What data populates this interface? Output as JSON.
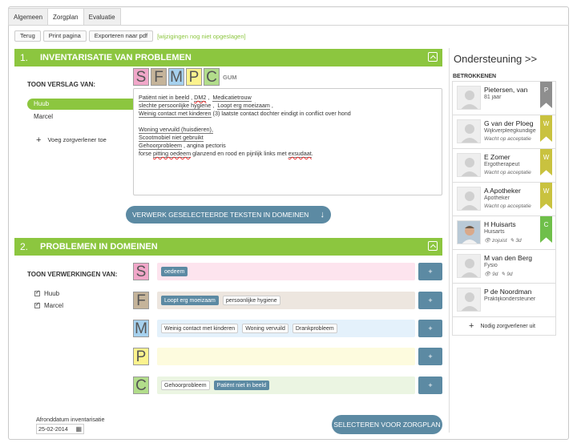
{
  "tabs": [
    {
      "label": "Algemeen"
    },
    {
      "label": "Zorgplan"
    },
    {
      "label": "Evaluatie"
    }
  ],
  "toolbar": {
    "back": "Terug",
    "print": "Print pagina",
    "export": "Exporteren naar pdf",
    "warning": "[wijzigingen nog niet opgeslagen]"
  },
  "section1": {
    "number": "1.",
    "title": "INVENTARISATIE VAN PROBLEMEN",
    "show_report_label": "TOON VERSLAG VAN:",
    "reporters": [
      "Huub",
      "Marcel"
    ],
    "add_caregiver": "Voeg zorgverlener toe",
    "letters": [
      "S",
      "F",
      "M",
      "P",
      "C"
    ],
    "letter_colors": [
      "#f1a7c9",
      "#c5b49a",
      "#a6d1ee",
      "#fbf28e",
      "#b2dd8b"
    ],
    "eraser": "GUM",
    "text_lines": {
      "l1a": "Patiënt niet in beeld",
      "l1b": "DM2",
      "l1c": "Medicatietrouw",
      "l2a": "slechte persoonlijke hygiene",
      "l2b": "Loopt erg moeizaam",
      "l3a": "Weinig contact met kinderen",
      "l3b": " (3) laatste contact dochter eindigt in conflict over hond",
      "l4": "Woning vervuild (huisdieren),",
      "l5": "Scootmobiel niet gebruikt",
      "l6a": "Gehoorprobleem",
      "l6b": " , angina pectoris",
      "l7a": "forse ",
      "l7b": "pitting oedeem",
      "l7c": " glanzend en rood en pijnlijk links met ",
      "l7d": "exsudaat",
      "l7e": "."
    },
    "process_button": "VERWERK GESELECTEERDE TEKSTEN IN DOMEINEN"
  },
  "section2": {
    "number": "2.",
    "title": "PROBLEMEN IN DOMEINEN",
    "show_processing_label": "TOON VERWERKINGEN VAN:",
    "checkboxes": [
      "Huub",
      "Marcel"
    ],
    "domains": [
      {
        "letter": "S",
        "color": "#f1a7c9",
        "bar": "#fde4ee",
        "tags": [
          {
            "text": "oedeem",
            "selected": true
          }
        ]
      },
      {
        "letter": "F",
        "color": "#c5b49a",
        "bar": "#ede6df",
        "tags": [
          {
            "text": "Loopt erg moeizaam",
            "selected": true
          },
          {
            "text": "persoonlijke hygiene",
            "selected": false
          }
        ]
      },
      {
        "letter": "M",
        "color": "#a6d1ee",
        "bar": "#e4f1fb",
        "tags": [
          {
            "text": "Weinig contact met kinderen",
            "selected": false
          },
          {
            "text": "Woning vervuild",
            "selected": false
          },
          {
            "text": "Drankprobleem",
            "selected": false
          }
        ]
      },
      {
        "letter": "P",
        "color": "#fbf28e",
        "bar": "#fdfbde",
        "tags": []
      },
      {
        "letter": "C",
        "color": "#b2dd8b",
        "bar": "#ebf5e2",
        "tags": [
          {
            "text": "Gehoorprobleem",
            "selected": false
          },
          {
            "text": "Patiënt niet in beeld",
            "selected": true
          }
        ]
      }
    ],
    "add": "+",
    "end_date_label": "Afronddatum inventarisatie",
    "end_date": "25-02-2014",
    "select_button": "SELECTEREN VOOR ZORGPLAN"
  },
  "sidebar": {
    "title": "Ondersteuning >>",
    "subtitle": "BETROKKENEN",
    "people": [
      {
        "name": "Pietersen, van",
        "role": "81 jaar",
        "status": "",
        "badge": "P",
        "badge_color": "#8e8e8e"
      },
      {
        "name": "G van der Ploeg",
        "role": "Wijkverpleegkundige",
        "status": "Wacht op acceptatie",
        "badge": "W",
        "badge_color": "#c9c23f"
      },
      {
        "name": "E Zomer",
        "role": "Ergotherapeut",
        "status": "Wacht op acceptatie",
        "badge": "W",
        "badge_color": "#c9c23f"
      },
      {
        "name": "A Apotheker",
        "role": "Apotheker",
        "status": "Wacht op acceptatie",
        "badge": "W",
        "badge_color": "#c9c23f"
      },
      {
        "name": "H Huisarts",
        "role": "Huisarts",
        "seen": "zojuist",
        "edited": "3d",
        "badge": "C",
        "badge_color": "#6fbf4a"
      },
      {
        "name": "M van den Berg",
        "role": "Fysio",
        "seen": "9d",
        "edited": "9d",
        "badge": "",
        "badge_color": ""
      },
      {
        "name": "P de Noordman",
        "role": "Praktijkondersteuner",
        "status": "",
        "badge": "",
        "badge_color": ""
      }
    ],
    "invite": "Nodig zorgverlener uit"
  }
}
